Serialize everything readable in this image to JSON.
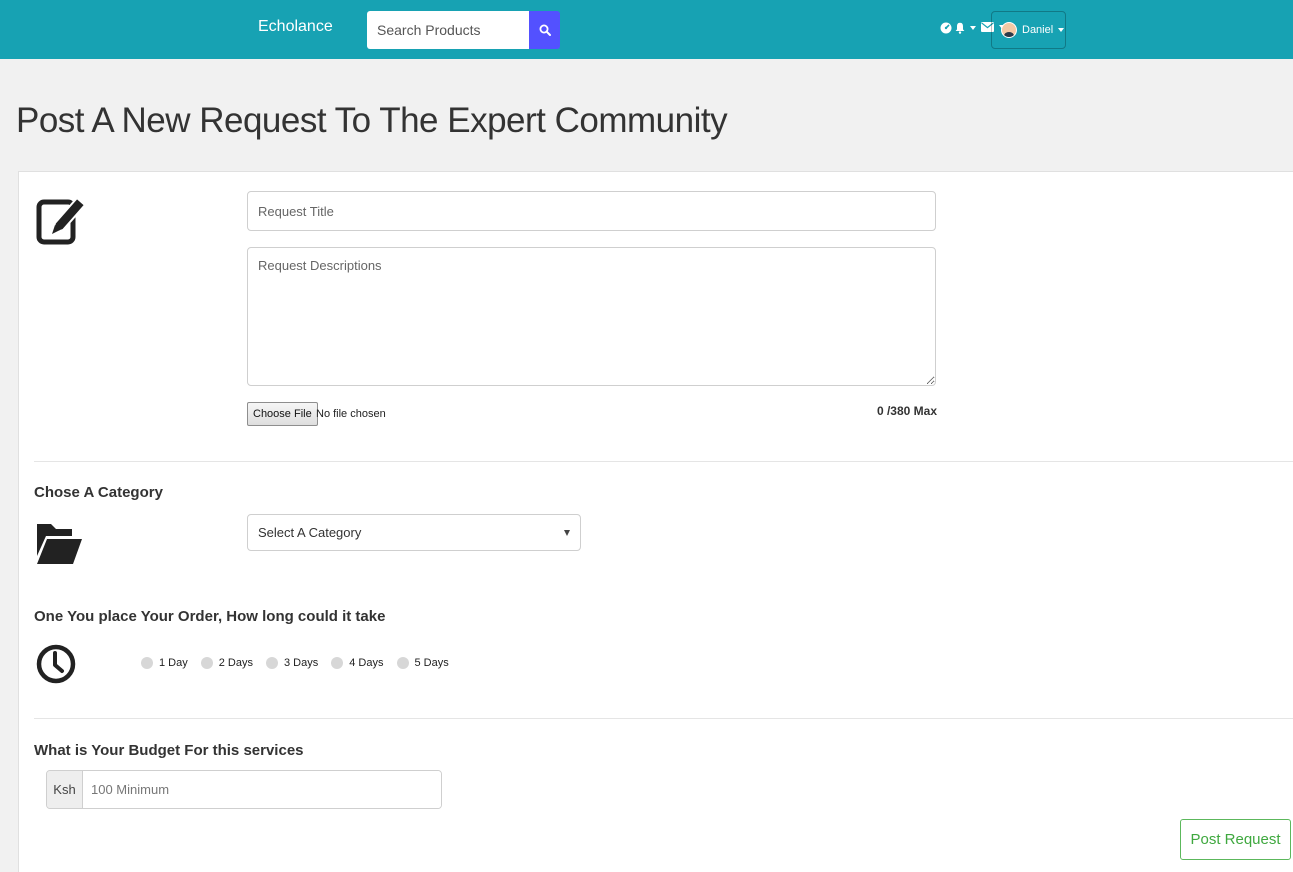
{
  "navbar": {
    "brand": "Echolance",
    "search_placeholder": "Search Products",
    "user_name": "Daniel"
  },
  "page": {
    "title": "Post A New Request To The Expert Community"
  },
  "request_form": {
    "title_placeholder": "Request Title",
    "description_placeholder": "Request Descriptions",
    "choose_file_label": "Choose File",
    "file_status": "No file chosen",
    "char_count": "0 /380 Max"
  },
  "category": {
    "label": "Chose A Category",
    "selected": "Select A Category"
  },
  "duration": {
    "label": "One You place Your Order, How long could it take",
    "options": [
      "1 Day",
      "2 Days",
      "3 Days",
      "4 Days",
      "5 Days"
    ]
  },
  "budget": {
    "label": "What is Your Budget For this services",
    "currency": "Ksh",
    "placeholder": "100 Minimum"
  },
  "actions": {
    "post_label": "Post Request"
  },
  "colors": {
    "navbar": "#17a2b3",
    "search_button": "#5351ff",
    "post_button": "#5cb85c"
  }
}
